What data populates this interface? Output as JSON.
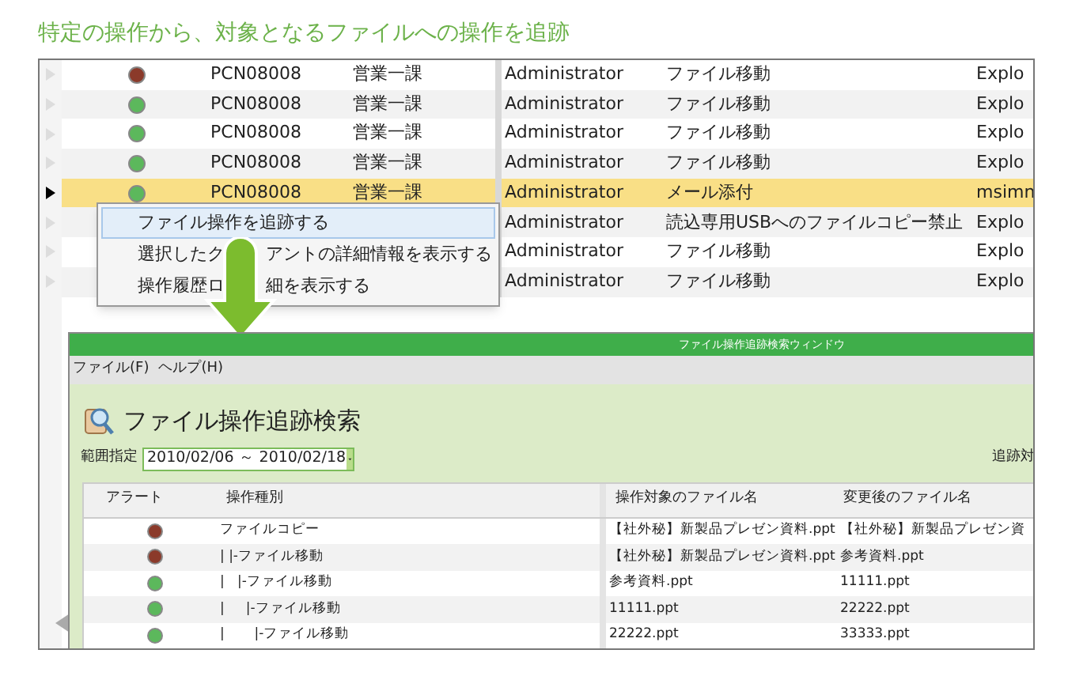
{
  "caption": "特定の操作から、対象となるファイルへの操作を追跡",
  "list": {
    "rows": [
      {
        "selected": false,
        "color": "#8b3a2a",
        "pc": "PCN08008",
        "department": "営業一課",
        "user": "Administrator",
        "operation": "ファイル移動",
        "app": "Explo"
      },
      {
        "selected": false,
        "color": "#5cb85c",
        "pc": "PCN08008",
        "department": "営業一課",
        "user": "Administrator",
        "operation": "ファイル移動",
        "app": "Explo"
      },
      {
        "selected": false,
        "color": "#5cb85c",
        "pc": "PCN08008",
        "department": "営業一課",
        "user": "Administrator",
        "operation": "ファイル移動",
        "app": "Explo"
      },
      {
        "selected": false,
        "color": "#5cb85c",
        "pc": "PCN08008",
        "department": "営業一課",
        "user": "Administrator",
        "operation": "ファイル移動",
        "app": "Explo"
      },
      {
        "selected": true,
        "color": "#5cb85c",
        "pc": "PCN08008",
        "department": "営業一課",
        "user": "Administrator",
        "operation": "メール添付",
        "app": "msimn"
      },
      {
        "selected": false,
        "user": "Administrator",
        "operation": "読込専用USBへのファイルコピー禁止",
        "app": "Explo"
      },
      {
        "selected": false,
        "user": "Administrator",
        "operation": "ファイル移動",
        "app": "Explo"
      },
      {
        "selected": false,
        "user": "Administrator",
        "operation": "ファイル移動",
        "app": "Explo"
      }
    ]
  },
  "context_menu": {
    "items": [
      {
        "label_parts": [
          "ファイル操作を追跡する"
        ],
        "selected": true
      },
      {
        "label_parts": [
          "選択したク",
          "アントの詳細情報を表示する"
        ],
        "selected": false
      },
      {
        "label_parts": [
          "操作履歴ロ",
          "細を表示する"
        ],
        "selected": false
      }
    ]
  },
  "trace_window": {
    "title": "ファイル操作追跡検索ウィンドウ",
    "menu": [
      "ファイル(F)",
      "ヘルプ(H)"
    ],
    "heading": "ファイル操作追跡検索",
    "range_label": "範囲指定",
    "range_value": "2010/02/06 ～ 2010/02/18",
    "right_label": "追跡対",
    "table": {
      "columns": [
        "アラート",
        "操作種別",
        "操作対象のファイル名",
        "変更後のファイル名"
      ],
      "rows": [
        {
          "color": "#8b3a2a",
          "operation": "ファイルコピー",
          "file": "【社外秘】新製品プレゼン資料.ppt",
          "renamed": "【社外秘】新製品プレゼン資"
        },
        {
          "color": "#8b3a2a",
          "operation": "| |-ファイル移動",
          "file": "【社外秘】新製品プレゼン資料.ppt",
          "renamed": "参考資料.ppt"
        },
        {
          "color": "#5cb85c",
          "operation": "|   |-ファイル移動",
          "file": "参考資料.ppt",
          "renamed": "11111.ppt"
        },
        {
          "color": "#5cb85c",
          "operation": "|     |-ファイル移動",
          "file": "11111.ppt",
          "renamed": "22222.ppt"
        },
        {
          "color": "#5cb85c",
          "operation": "|       |-ファイル移動",
          "file": "22222.ppt",
          "renamed": "33333.ppt"
        }
      ]
    }
  }
}
